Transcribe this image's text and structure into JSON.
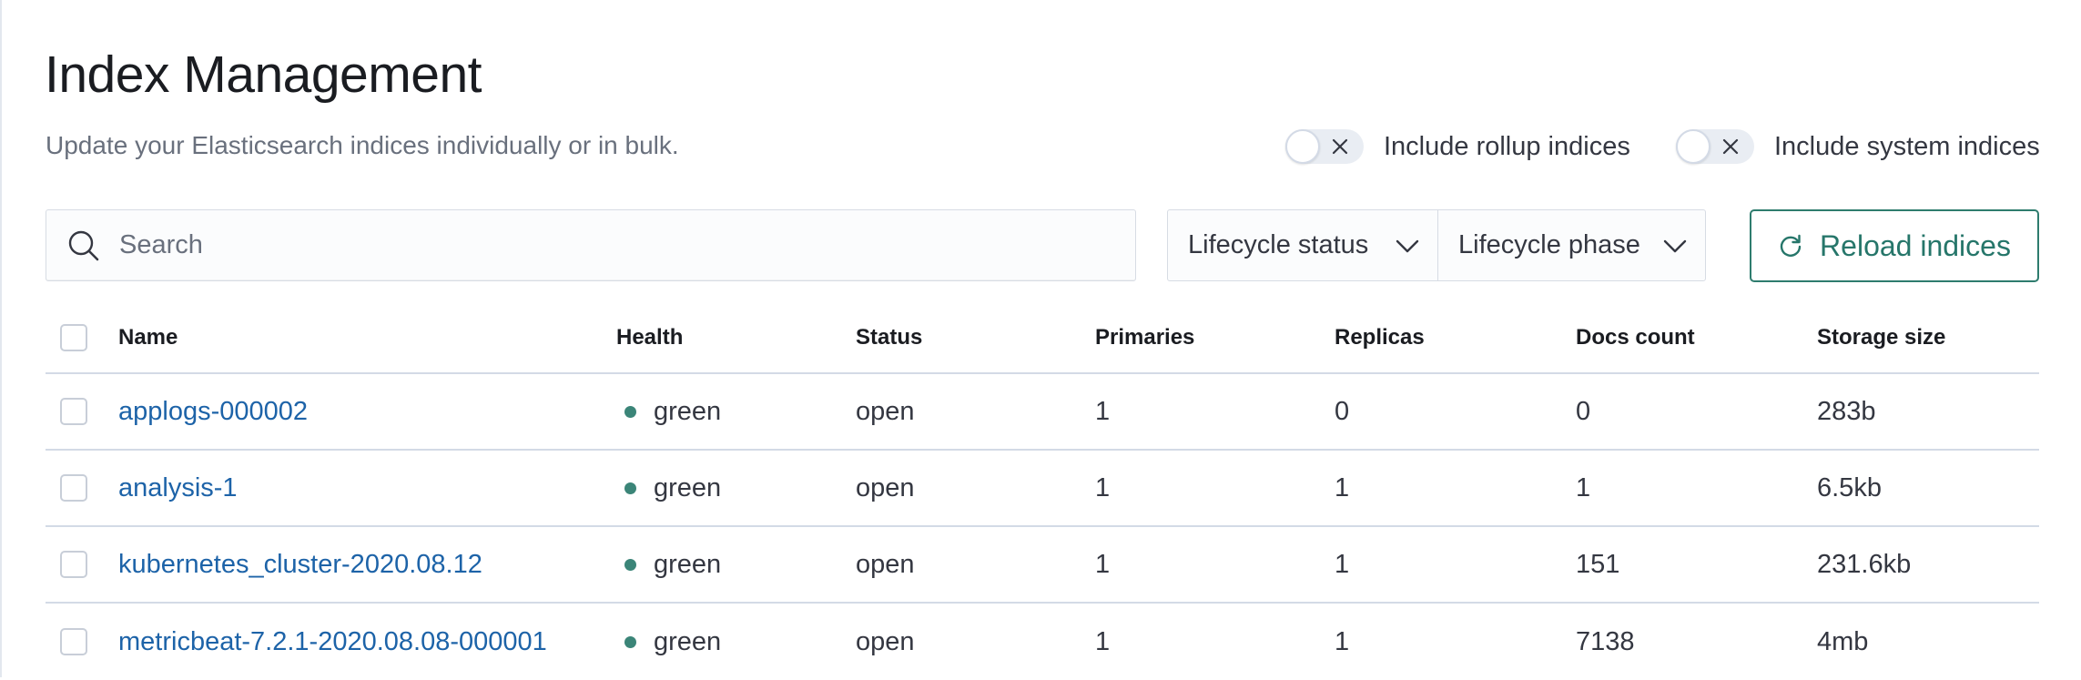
{
  "page": {
    "title": "Index Management",
    "subtitle": "Update your Elasticsearch indices individually or in bulk."
  },
  "toggles": [
    {
      "label": "Include rollup indices",
      "checked": false
    },
    {
      "label": "Include system indices",
      "checked": false
    }
  ],
  "search": {
    "placeholder": "Search",
    "value": "",
    "icon": "search-icon"
  },
  "filters": [
    {
      "label": "Lifecycle status",
      "icon": "chevron-down-icon"
    },
    {
      "label": "Lifecycle phase",
      "icon": "chevron-down-icon"
    }
  ],
  "reload": {
    "label": "Reload indices",
    "icon": "refresh-icon",
    "color": "#2e7c6e"
  },
  "table": {
    "columns": [
      "Name",
      "Health",
      "Status",
      "Primaries",
      "Replicas",
      "Docs count",
      "Storage size"
    ],
    "rows": [
      {
        "name": "applogs-000002",
        "health": "green",
        "status": "open",
        "primaries": "1",
        "replicas": "0",
        "docs": "0",
        "size": "283b"
      },
      {
        "name": "analysis-1",
        "health": "green",
        "status": "open",
        "primaries": "1",
        "replicas": "1",
        "docs": "1",
        "size": "6.5kb"
      },
      {
        "name": "kubernetes_cluster-2020.08.12",
        "health": "green",
        "status": "open",
        "primaries": "1",
        "replicas": "1",
        "docs": "151",
        "size": "231.6kb"
      },
      {
        "name": "metricbeat-7.2.1-2020.08.08-000001",
        "health": "green",
        "status": "open",
        "primaries": "1",
        "replicas": "1",
        "docs": "7138",
        "size": "4mb"
      }
    ]
  },
  "colors": {
    "health_green": "#3b8578",
    "link": "#1d63a8",
    "accent": "#2e7c6e"
  }
}
